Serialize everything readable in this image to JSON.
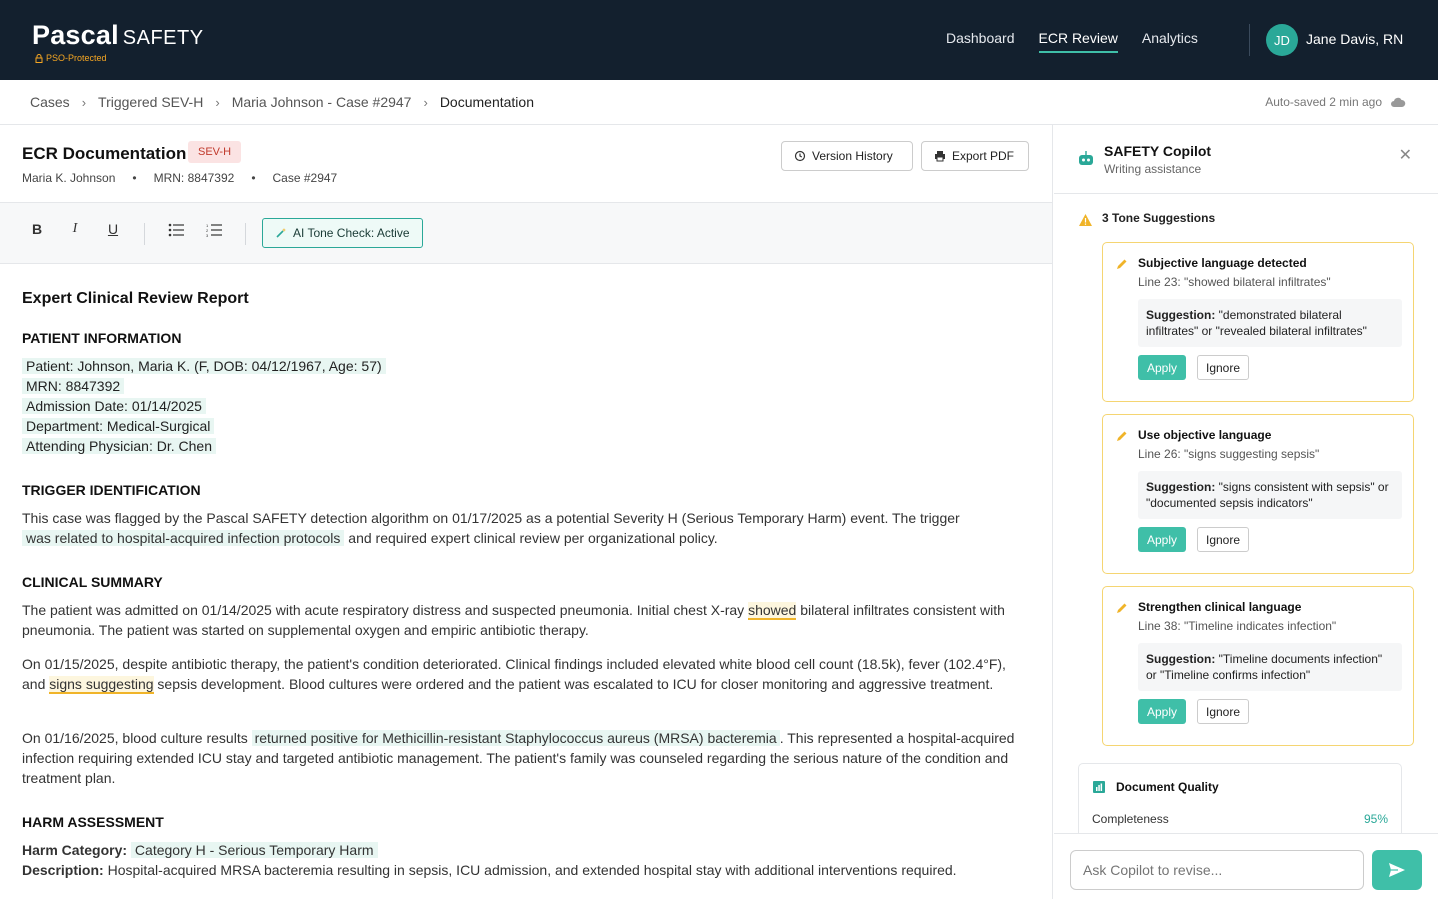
{
  "app": {
    "logo_main": "Pascal",
    "logo_sub": "SAFETY",
    "pso_label": "PSO-Protected"
  },
  "nav": {
    "items": [
      {
        "label": "Dashboard",
        "active": false
      },
      {
        "label": "ECR Review",
        "active": true
      },
      {
        "label": "Analytics",
        "active": false
      }
    ]
  },
  "user": {
    "initials": "JD",
    "name": "Jane Davis, RN"
  },
  "breadcrumb": {
    "items": [
      "Cases",
      "Triggered SEV-H",
      "Maria Johnson - Case #2947",
      "Documentation"
    ],
    "autosave": "Auto-saved 2 min ago"
  },
  "doc": {
    "title": "ECR Documentation",
    "severity": "SEV-H",
    "patient": "Maria K. Johnson",
    "mrn": "MRN: 8847392",
    "case": "Case #2947",
    "version_history": "Version History",
    "export_pdf": "Export PDF"
  },
  "toolbar": {
    "bold": "B",
    "italic": "I",
    "underline": "U",
    "ai_tone": "AI Tone Check: Active"
  },
  "report": {
    "title": "Expert Clinical Review Report",
    "patient_info_heading": "PATIENT INFORMATION",
    "patient_info": [
      "Patient: Johnson, Maria K. (F, DOB: 04/12/1967, Age: 57)",
      "MRN: 8847392",
      "Admission Date: 01/14/2025",
      "Department: Medical-Surgical",
      "Attending Physician: Dr. Chen"
    ],
    "trigger_heading": "TRIGGER IDENTIFICATION",
    "trigger_a": "This case was flagged by the Pascal SAFETY detection algorithm on 01/17/2025 as a potential Severity H (Serious Temporary Harm) event. The trigger",
    "trigger_hl": "was related to hospital-acquired infection protocols",
    "trigger_b": " and required expert clinical review per organizational policy.",
    "clinical_heading": "CLINICAL SUMMARY",
    "p1_a": "The patient was admitted on 01/14/2025 with acute respiratory distress and suspected pneumonia. Initial chest X-ray ",
    "p1_hl": "showed",
    "p1_b": " bilateral infiltrates consistent with pneumonia. The patient was started on supplemental oxygen and empiric antibiotic therapy.",
    "p2_a": "On 01/15/2025, despite antibiotic therapy, the patient's condition deteriorated. Clinical findings included elevated white blood cell count (18.5k), fever (102.4°F), and ",
    "p2_hl": "signs suggesting",
    "p2_b": " sepsis development. Blood cultures were ordered and the patient was escalated to ICU for closer monitoring and aggressive treatment.",
    "p3_a": "On 01/16/2025, blood culture results ",
    "p3_hl": "returned positive for Methicillin-resistant Staphylococcus aureus (MRSA) bacteremia",
    "p3_b": ". This represented a hospital-acquired infection requiring extended ICU stay and targeted antibiotic management. The patient's family was counseled regarding the serious nature of the condition and treatment plan.",
    "harm_heading": "HARM ASSESSMENT",
    "harm_cat_label": "Harm Category:",
    "harm_cat_value": "Category H - Serious Temporary Harm",
    "harm_desc_label": "Description:",
    "harm_desc_value": " Hospital-acquired MRSA bacteremia resulting in sepsis, ICU admission, and extended hospital stay with additional interventions required."
  },
  "copilot": {
    "title": "SAFETY Copilot",
    "subtitle": "Writing assistance",
    "tone_heading": "3 Tone Suggestions",
    "suggestions": [
      {
        "title": "Subjective language detected",
        "line": "Line 23: \"showed bilateral infiltrates\"",
        "label": "Suggestion:",
        "text": " \"demonstrated bilateral infiltrates\" or \"revealed bilateral infiltrates\"",
        "apply": "Apply",
        "ignore": "Ignore"
      },
      {
        "title": "Use objective language",
        "line": "Line 26: \"signs suggesting sepsis\"",
        "label": "Suggestion:",
        "text": " \"signs consistent with sepsis\" or \"documented sepsis indicators\"",
        "apply": "Apply",
        "ignore": "Ignore"
      },
      {
        "title": "Strengthen clinical language",
        "line": "Line 38: \"Timeline indicates infection\"",
        "label": "Suggestion:",
        "text": " \"Timeline documents infection\" or \"Timeline confirms infection\"",
        "apply": "Apply",
        "ignore": "Ignore"
      }
    ],
    "quality_title": "Document Quality",
    "completeness_label": "Completeness",
    "completeness_value": "95%",
    "ask_placeholder": "Ask Copilot to revise..."
  },
  "colors": {
    "topbar": "#13202e",
    "accent": "#3fbfa8",
    "severity": "#c0392b",
    "warning": "#f0b429"
  }
}
